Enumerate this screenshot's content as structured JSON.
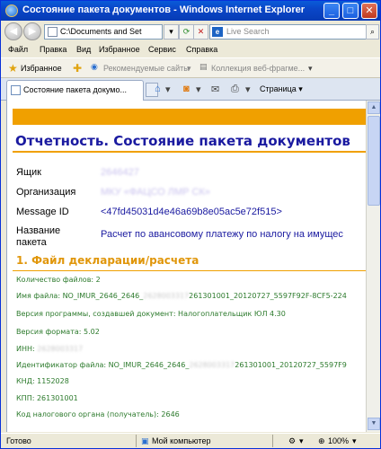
{
  "window": {
    "title": "Состояние пакета документов - Windows Internet Explorer"
  },
  "address": {
    "url": "C:\\Documents and Set"
  },
  "search": {
    "placeholder": "Live Search"
  },
  "menu": [
    "Файл",
    "Правка",
    "Вид",
    "Избранное",
    "Сервис",
    "Справка"
  ],
  "favorites": {
    "label": "Избранное",
    "items": [
      "Рекомендуемые сайты",
      "Коллекция веб-фрагме..."
    ]
  },
  "tab": {
    "title": "Состояние пакета докумо..."
  },
  "toolbar": {
    "page_label": "Страница"
  },
  "report": {
    "title": "Отчетность. Состояние пакета документов",
    "rows": [
      {
        "label": "Ящик",
        "value": "2646427"
      },
      {
        "label": "Организация",
        "value": "МКУ «ФАЦСО ЛМР СК»"
      },
      {
        "label": "Message ID",
        "value": "<47fd45031d4e46a69b8e05ac5e72f515>"
      },
      {
        "label": "Название пакета",
        "value": "Расчет по авансовому платежу по налогу на имущес"
      }
    ],
    "section_title": "1. Файл декларации/расчета",
    "details": [
      {
        "text": "Количество файлов: 2"
      },
      {
        "text": "Имя файла: NO_IMUR_2646_2646_",
        "blur": "2628003317",
        "tail": "261301001_20120727_5597F92F-8CF5-224"
      },
      {
        "text": "Версия программы, создавшей документ: Налогоплательщик ЮЛ 4.30"
      },
      {
        "text": "Версия формата: 5.02"
      },
      {
        "text": "ИНН: ",
        "blur": "2628003317"
      },
      {
        "text": "Идентификатор файла: NO_IMUR_2646_2646_",
        "blur": "2628003317",
        "tail": "261301001_20120727_5597F9"
      },
      {
        "text": "КНД: 1152028"
      },
      {
        "text": "КПП: 261301001"
      },
      {
        "text": "Код налогового органа (получатель): 2646"
      }
    ]
  },
  "status": {
    "left": "Готово",
    "zone": "Мой компьютер",
    "zoom": "100%"
  }
}
